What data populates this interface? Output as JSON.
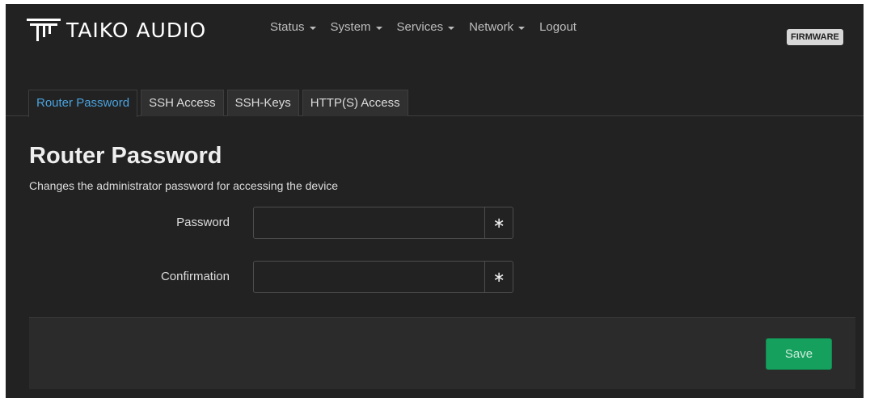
{
  "brand": {
    "name": "TAIKO AUDIO",
    "logo_icon": "taiko-logo-icon"
  },
  "nav": {
    "items": [
      {
        "label": "Status",
        "has_menu": true
      },
      {
        "label": "System",
        "has_menu": true
      },
      {
        "label": "Services",
        "has_menu": true
      },
      {
        "label": "Network",
        "has_menu": true
      },
      {
        "label": "Logout",
        "has_menu": false
      }
    ],
    "firmware_badge": "FIRMWARE"
  },
  "tabs": [
    {
      "label": "Router Password",
      "active": true
    },
    {
      "label": "SSH Access",
      "active": false
    },
    {
      "label": "SSH-Keys",
      "active": false
    },
    {
      "label": "HTTP(S) Access",
      "active": false
    }
  ],
  "page": {
    "title": "Router Password",
    "description": "Changes the administrator password for accessing the device"
  },
  "form": {
    "password": {
      "label": "Password",
      "value": "",
      "reveal_glyph": "∗"
    },
    "confirmation": {
      "label": "Confirmation",
      "value": "",
      "reveal_glyph": "∗"
    }
  },
  "footer": {
    "save_label": "Save"
  },
  "colors": {
    "background": "#222222",
    "active_tab": "#4aa3df",
    "save_button": "#16a05d"
  }
}
